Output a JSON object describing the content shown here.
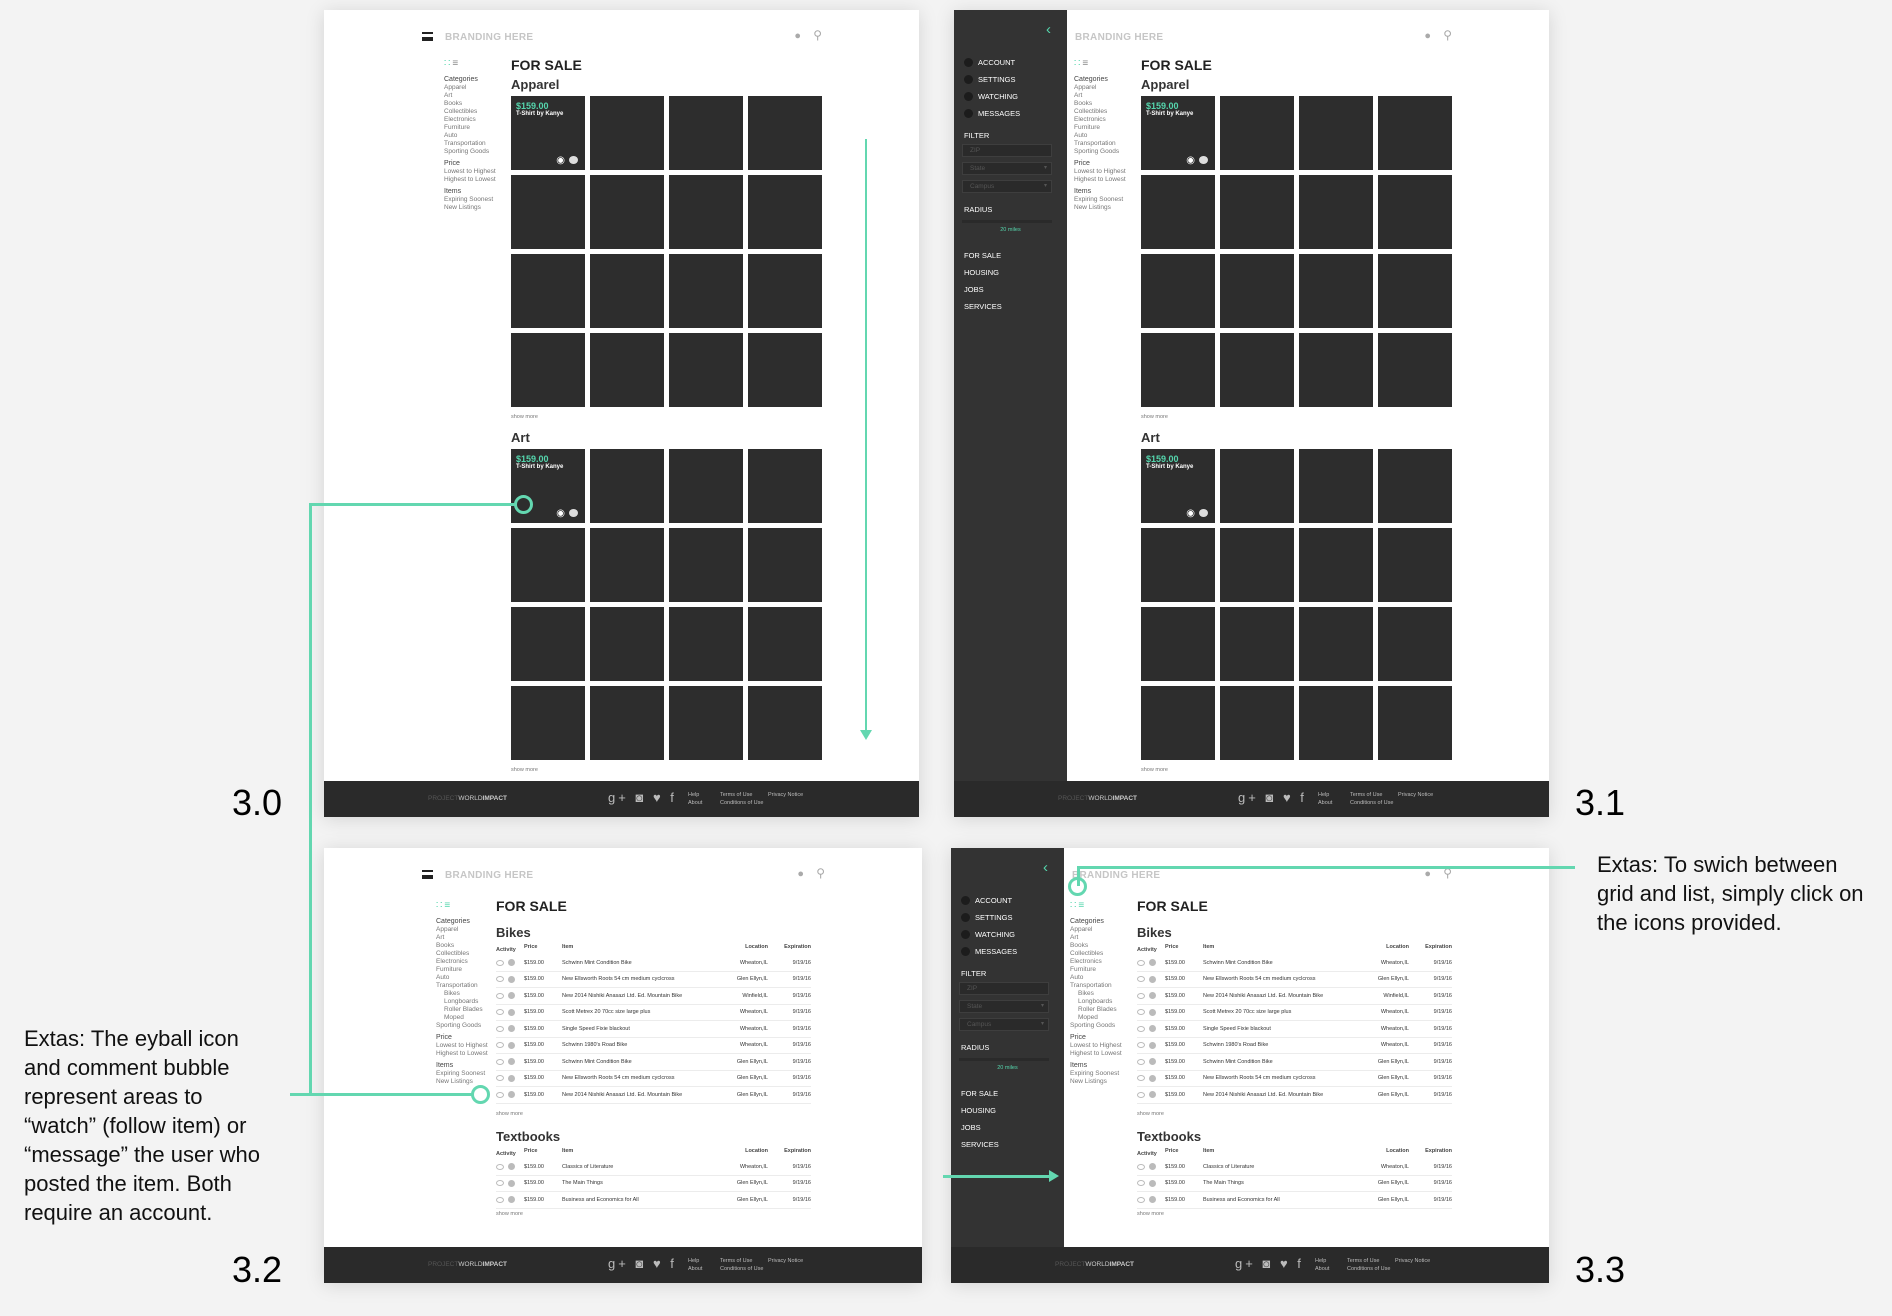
{
  "header": {
    "brand": "BRANDING HERE",
    "user_icon": "user-icon",
    "search_icon": "search-icon"
  },
  "page_title": "FOR SALE",
  "view_toggle": {
    "grid_icon": "grid-view-icon",
    "list_icon": "list-view-icon"
  },
  "filters": {
    "categories_label": "Categories",
    "categories": [
      "Apparel",
      "Art",
      "Books",
      "Collectibles",
      "Electronics",
      "Furniture",
      "Auto",
      "Transportation",
      "Sporting Goods"
    ],
    "categories_expanded": [
      "Apparel",
      "Art",
      "Books",
      "Collectibles",
      "Electronics",
      "Furniture",
      "Auto",
      "Transportation"
    ],
    "transportation_sub": [
      "Bikes",
      "Longboards",
      "Roller Blades",
      "Moped"
    ],
    "sporting_goods": "Sporting Goods",
    "price_label": "Price",
    "price_options": [
      "Lowest to Highest",
      "Highest to Lowest"
    ],
    "items_label": "Items",
    "items_options": [
      "Expiring Soonest",
      "New Listings"
    ]
  },
  "grid_sections": [
    {
      "title": "Apparel"
    },
    {
      "title": "Art"
    }
  ],
  "featured_tile": {
    "price": "$159.00",
    "name": "T-Shirt by Kanye"
  },
  "show_more": "show more",
  "footer": {
    "logo_prefix": "PROJECT",
    "logo_a": "WORLD",
    "logo_b": "IMPACT",
    "social": [
      "g+",
      "◙",
      "♥",
      "f"
    ],
    "help": "Help",
    "about": "About",
    "terms": "Terms of Use",
    "conditions": "Conditions of Use",
    "privacy": "Privacy Notice"
  },
  "sidebar": {
    "nav": [
      "ACCOUNT",
      "SETTINGS",
      "WATCHING",
      "MESSAGES"
    ],
    "filter_label": "FILTER",
    "zip_placeholder": "ZIP",
    "state_label": "State",
    "campus_label": "Campus",
    "radius_label": "RADIUS",
    "radius_value": "20 miles",
    "sections": [
      "FOR SALE",
      "HOUSING",
      "JOBS",
      "SERVICES"
    ]
  },
  "table_headers": [
    "Activity",
    "Price",
    "Item",
    "Location",
    "Expiration"
  ],
  "bikes": {
    "title": "Bikes",
    "rows": [
      {
        "price": "$159.00",
        "item": "Schwinn Mint Condition Bike",
        "location": "Wheaton,IL",
        "exp": "9/19/16"
      },
      {
        "price": "$159.00",
        "item": "New Ellsworth Roots 54 cm medium cyclcross",
        "location": "Glen Ellyn,IL",
        "exp": "9/19/16"
      },
      {
        "price": "$159.00",
        "item": "New 2014 Nishiki Anasazi Ltd. Ed. Mountain Bike",
        "location": "Winfield,IL",
        "exp": "9/19/16"
      },
      {
        "price": "$159.00",
        "item": "Scott Metrex 20 70cc size large plus",
        "location": "Wheaton,IL",
        "exp": "9/19/16"
      },
      {
        "price": "$159.00",
        "item": "Single Speed Fixie blackout",
        "location": "Wheaton,IL",
        "exp": "9/19/16"
      },
      {
        "price": "$159.00",
        "item": "Schwinn 1980's Road Bike",
        "location": "Wheaton,IL",
        "exp": "9/19/16"
      },
      {
        "price": "$159.00",
        "item": "Schwinn Mint Condition Bike",
        "location": "Glen Ellyn,IL",
        "exp": "9/19/16"
      },
      {
        "price": "$159.00",
        "item": "New Ellsworth Roots 54 cm medium cyclcross",
        "location": "Glen Ellyn,IL",
        "exp": "9/19/16"
      },
      {
        "price": "$159.00",
        "item": "New 2014 Nishiki Anasazi Ltd. Ed. Mountain Bike",
        "location": "Glen Ellyn,IL",
        "exp": "9/19/16"
      }
    ]
  },
  "textbooks": {
    "title": "Textbooks",
    "rows": [
      {
        "price": "$159.00",
        "item": "Classics of Literature",
        "location": "Wheaton,IL",
        "exp": "9/19/16"
      },
      {
        "price": "$159.00",
        "item": "The Main Things",
        "location": "Glen Ellyn,IL",
        "exp": "9/19/16"
      },
      {
        "price": "$159.00",
        "item": "Business and Economics for All",
        "location": "Glen Ellyn,IL",
        "exp": "9/19/16"
      }
    ]
  },
  "labels": {
    "s30": "3.0",
    "s31": "3.1",
    "s32": "3.2",
    "s33": "3.3"
  },
  "notes": {
    "eyeball": "Extas: The eyball icon and comment bubble represent areas to “watch” (follow item) or  “message” the user who posted the item. Both require an account.",
    "toggle": "Extas: To swich between grid and list, simply click on the icons provided."
  },
  "colors": {
    "accent": "#55d6ad",
    "dark_tile": "#2d2d2d",
    "sidebar": "#333333",
    "footer": "#2a2a2a"
  }
}
